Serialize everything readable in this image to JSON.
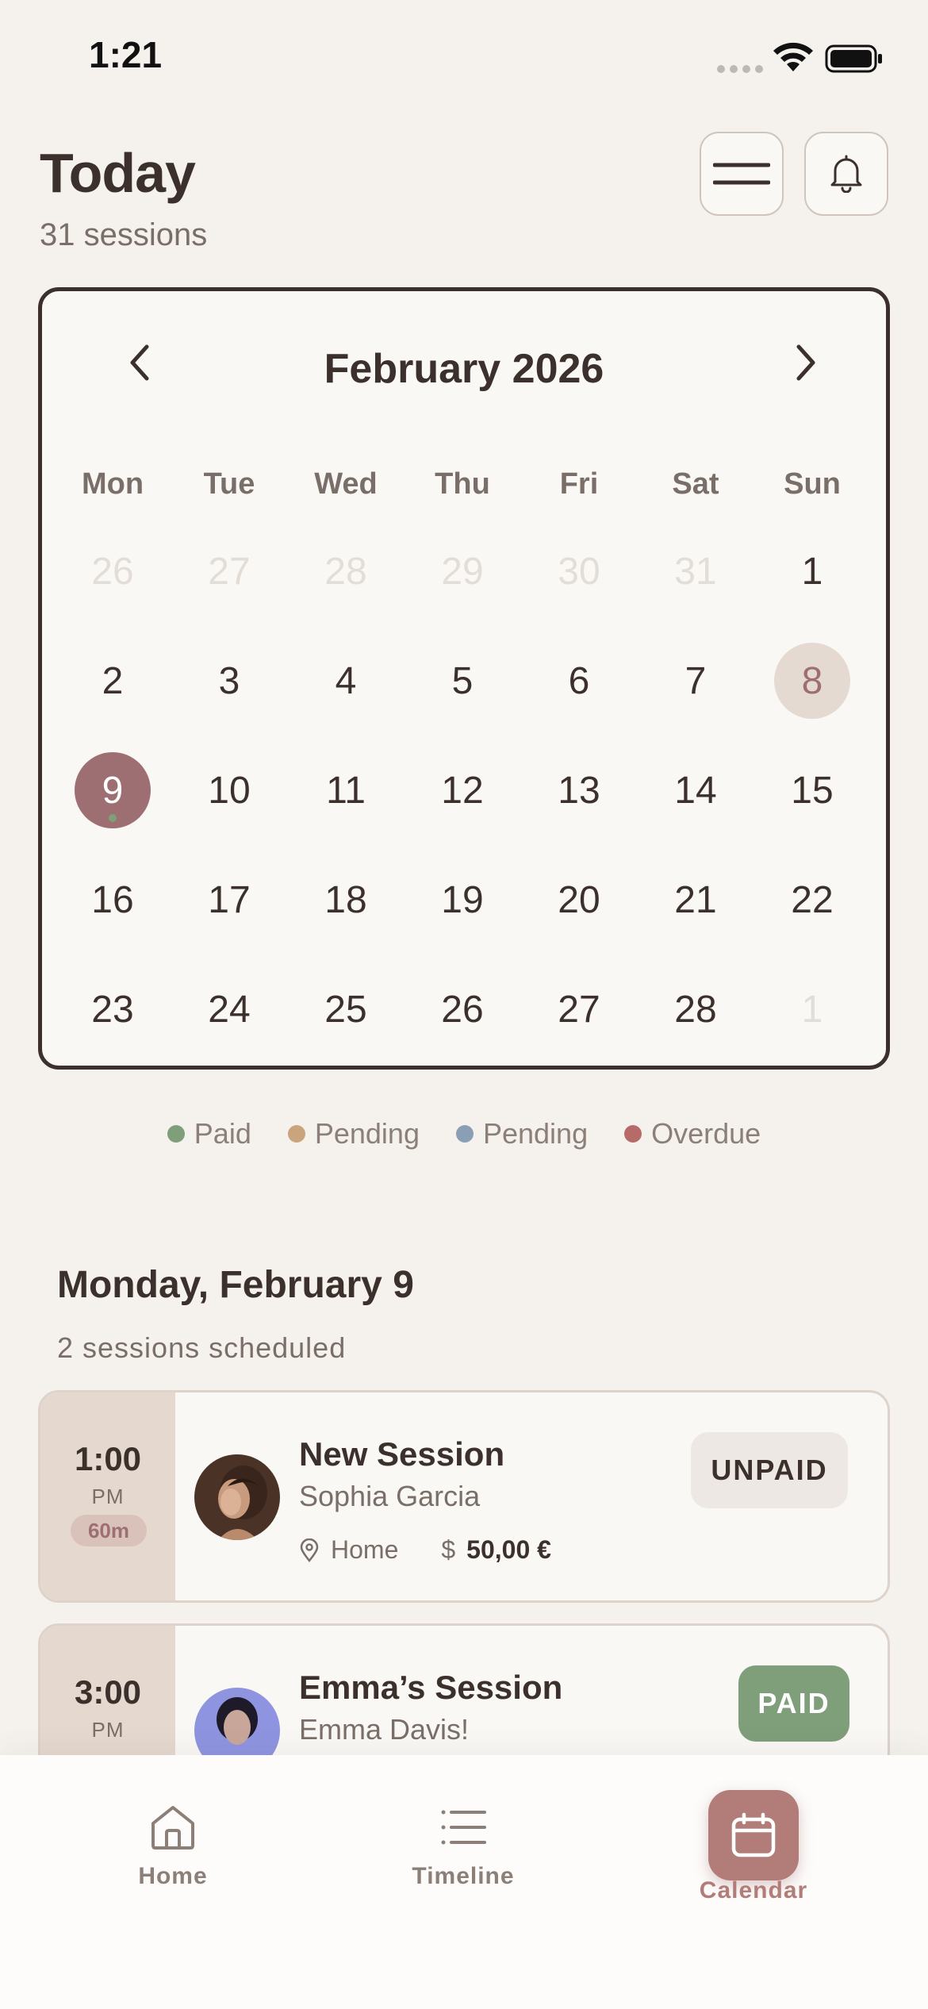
{
  "status_bar": {
    "time": "1:21"
  },
  "header": {
    "title": "Today",
    "subtitle": "31 sessions"
  },
  "calendar": {
    "month_label": "February 2026",
    "weekdays": [
      "Mon",
      "Tue",
      "Wed",
      "Thu",
      "Fri",
      "Sat",
      "Sun"
    ],
    "weeks": [
      [
        "26",
        "27",
        "28",
        "29",
        "30",
        "31",
        "1"
      ],
      [
        "2",
        "3",
        "4",
        "5",
        "6",
        "7",
        "8"
      ],
      [
        "9",
        "10",
        "11",
        "12",
        "13",
        "14",
        "15"
      ],
      [
        "16",
        "17",
        "18",
        "19",
        "20",
        "21",
        "22"
      ],
      [
        "23",
        "24",
        "25",
        "26",
        "27",
        "28",
        "1"
      ]
    ]
  },
  "legend": [
    {
      "label": "Paid",
      "color": "#7f9e7a"
    },
    {
      "label": "Pending",
      "color": "#c9a47c"
    },
    {
      "label": "Pending",
      "color": "#8a9eb4"
    },
    {
      "label": "Overdue",
      "color": "#b66b68"
    }
  ],
  "day_section": {
    "title": "Monday, February 9",
    "subtitle": "2 sessions scheduled"
  },
  "sessions": [
    {
      "time": "1:00",
      "ampm": "PM",
      "duration": "60m",
      "title": "New Session",
      "client": "Sophia Garcia",
      "location": "Home",
      "price": "50,00 €",
      "status": "UNPAID"
    },
    {
      "time": "3:00",
      "ampm": "PM",
      "title": "Emma’s Session",
      "client": "Emma Davis!",
      "status": "PAID"
    }
  ],
  "nav": {
    "home": "Home",
    "timeline": "Timeline",
    "calendar": "Calendar"
  },
  "colors": {
    "accent": "#9e6f72",
    "nav_accent": "#b27d79",
    "paid": "#7f9e7a",
    "background": "#f5f2ee"
  }
}
